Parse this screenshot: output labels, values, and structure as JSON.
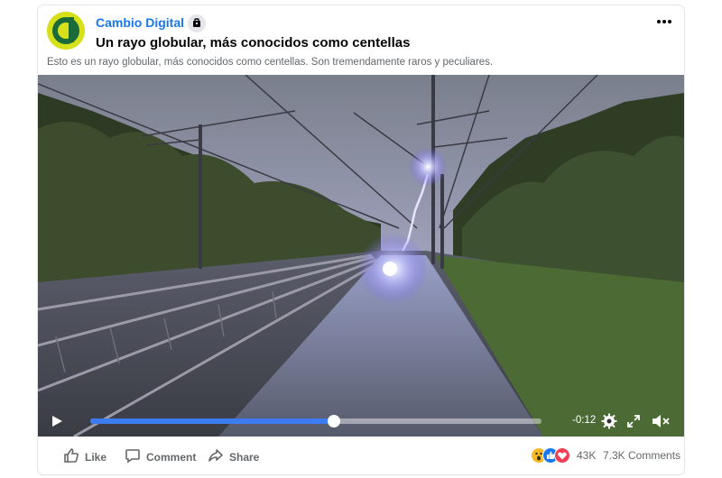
{
  "post": {
    "page_name": "Cambio Digital",
    "title": "Un rayo globular, más conocidos como centellas",
    "description": "Esto es un rayo globular, más conocidos como centellas. Son tremendamente raros y peculiares."
  },
  "video": {
    "progress": 0.54,
    "time_remaining": "-0:12"
  },
  "actions": {
    "like": "Like",
    "comment": "Comment",
    "share": "Share"
  },
  "stats": {
    "reactions_count": "43K",
    "comments_count": "7.3K Comments"
  },
  "colors": {
    "brand_link": "#1877f2",
    "progress": "#3c7cf0",
    "avatar_bg": "#d6e11a"
  },
  "icons": {
    "more": "more-dots-icon",
    "badge": "page-badge-icon",
    "play": "play-icon",
    "settings": "gear-icon",
    "fullscreen": "expand-icon",
    "volume": "mute-icon",
    "like": "thumbs-up-icon",
    "comment": "comment-bubble-icon",
    "share": "share-arrow-icon"
  }
}
